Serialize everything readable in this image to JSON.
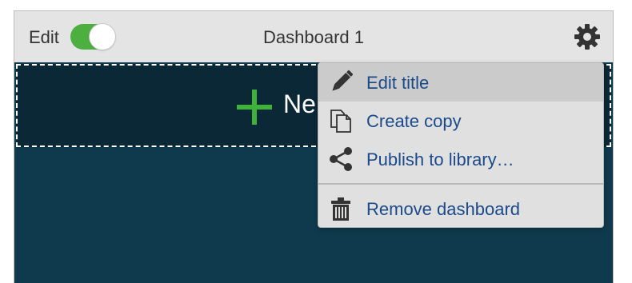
{
  "toolbar": {
    "edit_label": "Edit",
    "edit_toggle_on": true,
    "title": "Dashboard 1",
    "settings_icon": "gear-icon"
  },
  "canvas": {
    "new_tile_label": "Ne",
    "add_icon": "plus-icon"
  },
  "menu": {
    "items": [
      {
        "label": "Edit title",
        "icon": "pencil-icon"
      },
      {
        "label": "Create copy",
        "icon": "copy-icon"
      },
      {
        "label": "Publish to library…",
        "icon": "share-icon"
      },
      {
        "label": "Remove dashboard",
        "icon": "trash-icon"
      }
    ]
  },
  "colors": {
    "accent_green": "#4caf3f",
    "canvas_bg": "#0f3a4d",
    "menu_text": "#1a4a8a"
  }
}
